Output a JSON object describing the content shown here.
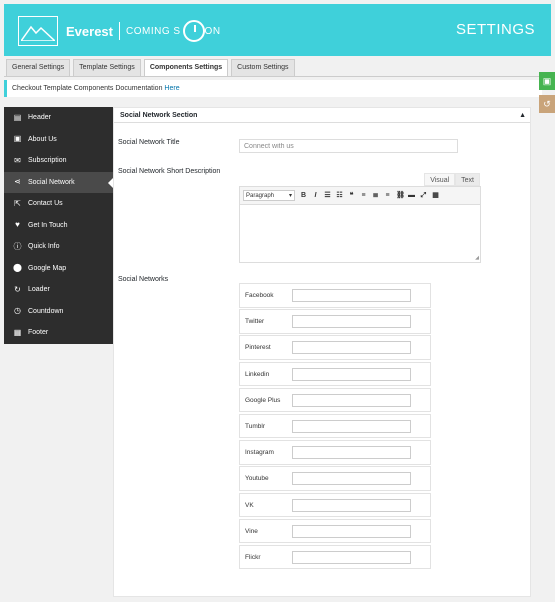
{
  "header": {
    "logo_name": "Everest",
    "logo_tagline": "COMING S",
    "logo_tagline_end": "ON",
    "title": "SETTINGS"
  },
  "tabs": [
    {
      "label": "General Settings",
      "active": false
    },
    {
      "label": "Template Settings",
      "active": false
    },
    {
      "label": "Components Settings",
      "active": true
    },
    {
      "label": "Custom Settings",
      "active": false
    }
  ],
  "notice": {
    "text": "Checkout Template Components Documentation",
    "link": "Here"
  },
  "floating": {
    "save_icon": "save-icon",
    "reset_icon": "reset-icon"
  },
  "sidebar": {
    "items": [
      {
        "label": "Header",
        "icon": "header-icon",
        "glyph": "▤",
        "active": false
      },
      {
        "label": "About Us",
        "icon": "about-icon",
        "glyph": "▣",
        "active": false
      },
      {
        "label": "Subscription",
        "icon": "envelope-icon",
        "glyph": "✉",
        "active": false
      },
      {
        "label": "Social Network",
        "icon": "share-icon",
        "glyph": "⋖",
        "active": true
      },
      {
        "label": "Contact Us",
        "icon": "contact-icon",
        "glyph": "⇱",
        "active": false
      },
      {
        "label": "Get In Touch",
        "icon": "heart-icon",
        "glyph": "♥",
        "active": false
      },
      {
        "label": "Quick Info",
        "icon": "info-icon",
        "glyph": "ⓘ",
        "active": false
      },
      {
        "label": "Google Map",
        "icon": "map-pin-icon",
        "glyph": "⬤",
        "active": false
      },
      {
        "label": "Loader",
        "icon": "loader-icon",
        "glyph": "↻",
        "active": false
      },
      {
        "label": "Countdown",
        "icon": "clock-icon",
        "glyph": "◷",
        "active": false
      },
      {
        "label": "Footer",
        "icon": "footer-icon",
        "glyph": "▦",
        "active": false
      }
    ]
  },
  "panel": {
    "section_title": "Social Network Section",
    "title_label": "Social Network Title",
    "title_value": "Connect with us",
    "desc_label": "Social Network Short Description",
    "editor_tabs": {
      "visual": "Visual",
      "text": "Text"
    },
    "format_select": "Paragraph",
    "networks_label": "Social Networks",
    "networks": [
      {
        "label": "Facebook",
        "value": ""
      },
      {
        "label": "Twitter",
        "value": ""
      },
      {
        "label": "Pinterest",
        "value": ""
      },
      {
        "label": "Linkedin",
        "value": ""
      },
      {
        "label": "Google Plus",
        "value": ""
      },
      {
        "label": "Tumblr",
        "value": ""
      },
      {
        "label": "Instagram",
        "value": ""
      },
      {
        "label": "Youtube",
        "value": ""
      },
      {
        "label": "VK",
        "value": ""
      },
      {
        "label": "Vine",
        "value": ""
      },
      {
        "label": "Flickr",
        "value": ""
      }
    ]
  },
  "colors": {
    "header_bg": "#3fd0da",
    "sidebar_bg": "#2d2d2d",
    "save_btn": "#46b450",
    "reset_btn": "#c9a47a"
  }
}
